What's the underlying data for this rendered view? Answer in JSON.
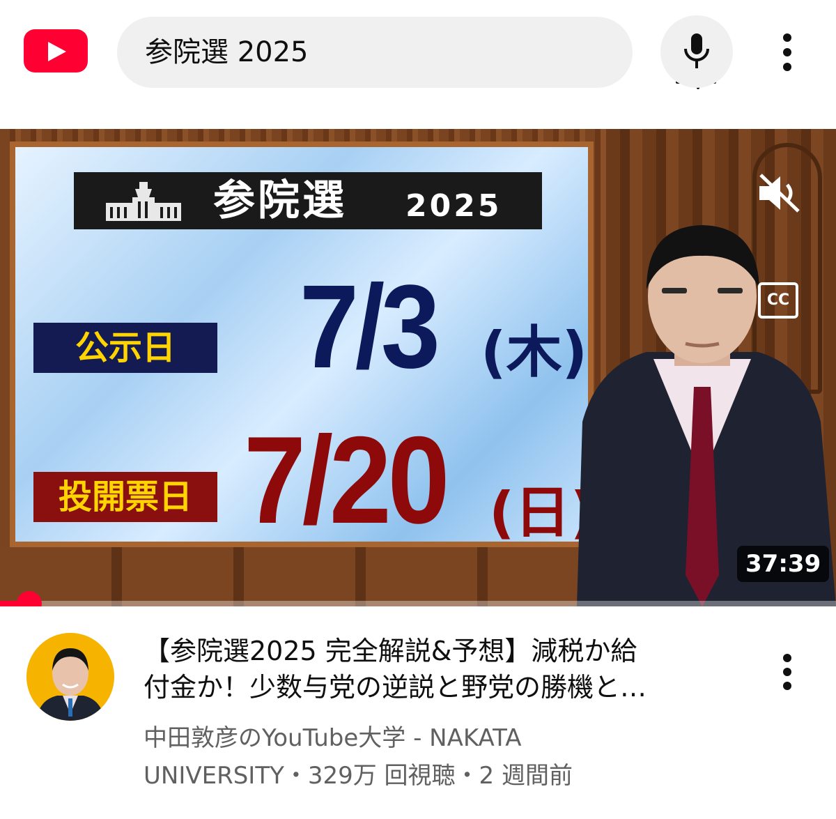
{
  "search": {
    "query": "参院選 2025"
  },
  "icons": {
    "logo": "youtube-logo-icon",
    "filter": "filter-sliders-icon",
    "mic": "microphone-icon",
    "more": "more-vert-icon",
    "mute": "volume-muted-icon",
    "cc": "closed-captions-icon"
  },
  "video": {
    "cc_label": "CC",
    "duration": "37:39",
    "progress": 0.035,
    "thumbnail": {
      "title": "参院選",
      "year": "2025",
      "label1": "公示日",
      "date1": "7/3",
      "dow1": "(木)",
      "label2": "投開票日",
      "date2": "7/20",
      "dow2": "(日)"
    },
    "title_line1": "【参院選2025 完全解説&予想】減税か給",
    "title_line2": "付金か！少数与党の逆説と野党の勝機と…",
    "channel_line1": "中田敦彦のYouTube大学 - NAKATA",
    "channel_line2": "UNIVERSITY・329万 回視聴・2 週間前"
  },
  "colors": {
    "brand_red": "#ff0033",
    "navy": "#141a52",
    "dark_red": "#8a1010",
    "label_yellow": "#ffd400"
  }
}
